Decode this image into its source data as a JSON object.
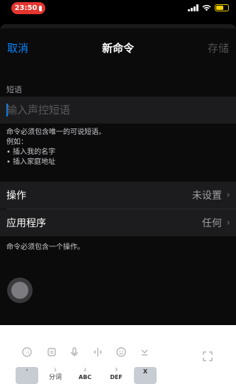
{
  "status_bar": {
    "time": "23:50",
    "accent_color": "#e5352f",
    "battery_color": "#f2cf00",
    "icons": [
      "mic-icon",
      "signal-icon",
      "wifi-icon",
      "battery-icon"
    ]
  },
  "nav": {
    "cancel_label": "取消",
    "title": "新命令",
    "save_label": "存储",
    "accent_color": "#0a84ff"
  },
  "phrase": {
    "section_label": "短语",
    "placeholder": "输入声控短语",
    "value": ""
  },
  "help": {
    "line1": "命令必须包含唯一的可说短语。",
    "line2": "例如：",
    "line3": "• 插入我的名字",
    "line4": "• 插入家庭地址"
  },
  "settings": {
    "action_label": "操作",
    "action_value": "未设置",
    "app_label": "应用程序",
    "app_value": "任何",
    "note": "命令必须包含一个操作。"
  },
  "keyboard": {
    "toolbar_icons": [
      "emoji-icon",
      "clipboard-icon",
      "microphone-icon",
      "cursor-icon",
      "smiley-icon",
      "hide-keyboard-icon",
      "expand-icon"
    ],
    "keys": [
      {
        "num": "",
        "label": "'"
      },
      {
        "num": "1",
        "label": "分词"
      },
      {
        "num": "2",
        "label": "ABC"
      },
      {
        "num": "3",
        "label": "DEF"
      },
      {
        "num": "",
        "label": "X"
      }
    ]
  }
}
